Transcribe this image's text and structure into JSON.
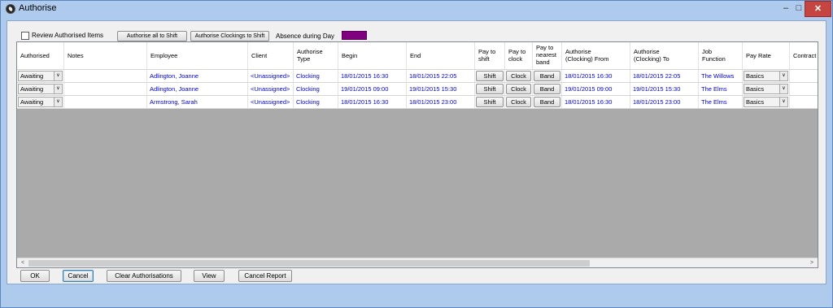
{
  "window": {
    "title": "Authorise",
    "minimize": "–",
    "maximize": "□",
    "close": "✕"
  },
  "topbar": {
    "review_label": "Review Authorised Items",
    "authorise_all_label": "Authorise all to Shift",
    "authorise_clockings_label": "Authorise Clockings to Shift",
    "absence_label": "Absence during Day",
    "absence_color": "#800080"
  },
  "grid": {
    "headers": [
      "Authorised",
      "Notes",
      "Employee",
      "Client",
      "Authorise\nType",
      "Begin",
      "End",
      "Pay to\nshift",
      "Pay to\nclock",
      "Pay to\nnearest\nband",
      "Authorise\n(Clocking) From",
      "Authorise\n(Clocking) To",
      "Job\nFunction",
      "Pay Rate",
      "Contract"
    ],
    "rows": [
      {
        "authorised": "Awaiting",
        "notes": "",
        "employee": "Adlington, Joanne",
        "client": "<Unassigned>",
        "type": "Clocking",
        "begin": "18/01/2015 16:30",
        "end": "18/01/2015 22:05",
        "shift": "Shift",
        "clock": "Clock",
        "band": "Band",
        "from": "18/01/2015 16:30",
        "to": "18/01/2015 22:05",
        "job": "The Willows",
        "pay_rate": "Basics",
        "contract": ""
      },
      {
        "authorised": "Awaiting",
        "notes": "",
        "employee": "Adlington, Joanne",
        "client": "<Unassigned>",
        "type": "Clocking",
        "begin": "19/01/2015 09:00",
        "end": "19/01/2015 15:30",
        "shift": "Shift",
        "clock": "Clock",
        "band": "Band",
        "from": "19/01/2015 09:00",
        "to": "19/01/2015 15:30",
        "job": "The Elms",
        "pay_rate": "Basics",
        "contract": ""
      },
      {
        "authorised": "Awaiting",
        "notes": "",
        "employee": "Armstrong, Sarah",
        "client": "<Unassigned>",
        "type": "Clocking",
        "begin": "18/01/2015 16:30",
        "end": "18/01/2015 23:00",
        "shift": "Shift",
        "clock": "Clock",
        "band": "Band",
        "from": "18/01/2015 16:30",
        "to": "18/01/2015 23:00",
        "job": "The Elms",
        "pay_rate": "Basics",
        "contract": ""
      }
    ],
    "scroll_left": "<",
    "scroll_right": ">"
  },
  "bottom": {
    "ok": "OK",
    "cancel": "Cancel",
    "clear": "Clear Authorisations",
    "view": "View",
    "cancel_report": "Cancel Report"
  },
  "icons": {
    "dropdown": "chevron-down-icon"
  }
}
